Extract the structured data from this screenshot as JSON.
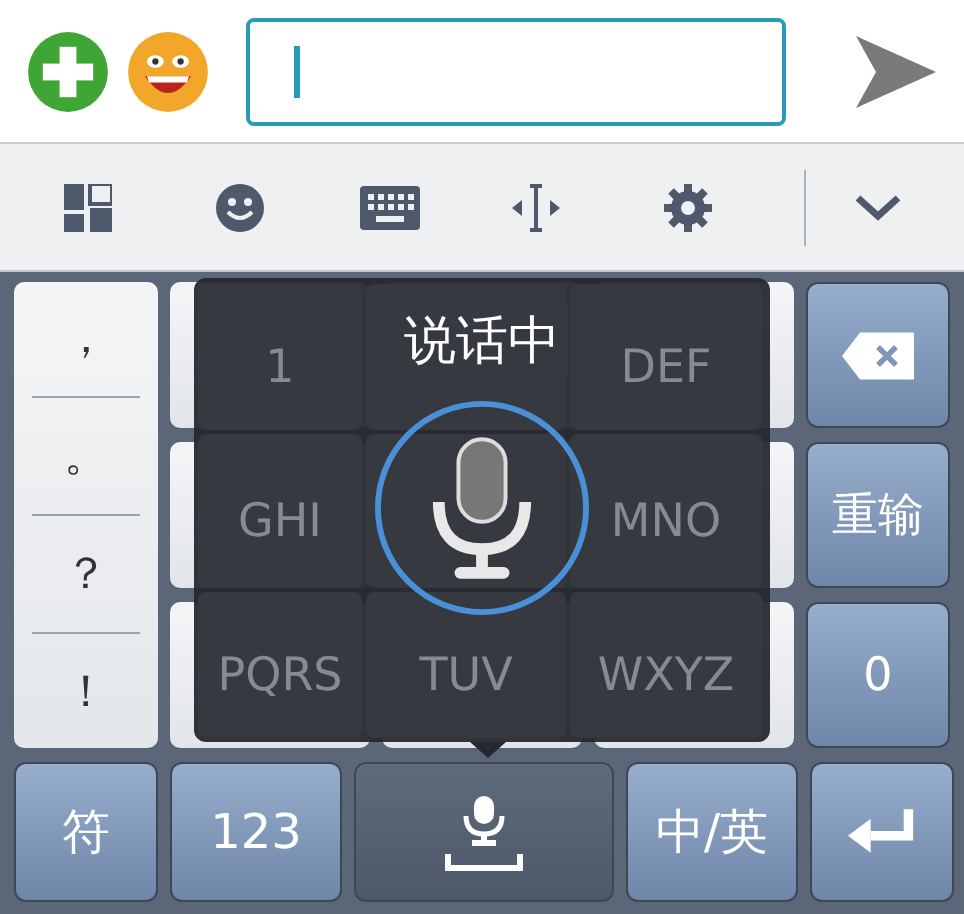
{
  "keyboard": {
    "punctuation": [
      "，",
      "。",
      "？",
      "！"
    ],
    "keypad": [
      {
        "label": "1"
      },
      {
        "label": "DEF"
      },
      {
        "label": "GHI"
      },
      {
        "label": "MNO"
      },
      {
        "label": "PQRS"
      },
      {
        "label": "TUV"
      },
      {
        "label": "WXYZ"
      }
    ],
    "side_keys": [
      {
        "kind": "backspace"
      },
      {
        "kind": "text",
        "label": "重输"
      },
      {
        "kind": "text",
        "label": "0"
      }
    ],
    "bottom_row": [
      {
        "kind": "text",
        "label": "符",
        "selected": false
      },
      {
        "kind": "text",
        "label": "123",
        "selected": false
      },
      {
        "kind": "voice",
        "selected": true
      },
      {
        "kind": "text",
        "label": "中/英",
        "selected": false
      },
      {
        "kind": "enter",
        "selected": false
      }
    ]
  },
  "voice_popup": {
    "status": "说话中"
  }
}
